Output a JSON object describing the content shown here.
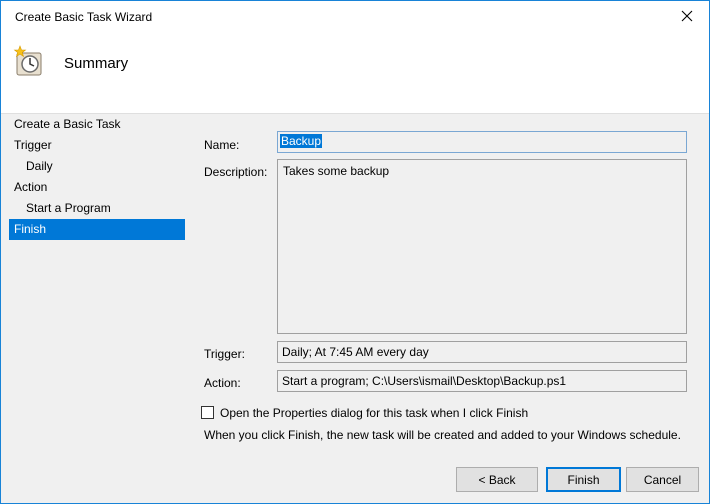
{
  "window": {
    "title": "Create Basic Task Wizard"
  },
  "header": {
    "title": "Summary"
  },
  "nav": {
    "items": [
      {
        "label": "Create a Basic Task"
      },
      {
        "label": "Trigger"
      },
      {
        "label": "Daily"
      },
      {
        "label": "Action"
      },
      {
        "label": "Start a Program"
      },
      {
        "label": "Finish"
      }
    ]
  },
  "form": {
    "name_label": "Name:",
    "name_value": "Backup",
    "description_label": "Description:",
    "description_value": "Takes some backup",
    "trigger_label": "Trigger:",
    "trigger_value": "Daily; At 7:45 AM every day",
    "action_label": "Action:",
    "action_value": "Start a program; C:\\Users\\ismail\\Desktop\\Backup.ps1",
    "checkbox_label": "Open the Properties dialog for this task when I click Finish",
    "checkbox_checked": false,
    "info_text": "When you click Finish, the new task will be created and added to your Windows schedule."
  },
  "buttons": {
    "back": "< Back",
    "finish": "Finish",
    "cancel": "Cancel"
  },
  "colors": {
    "accent": "#0078d7",
    "window_border": "#1883d7",
    "background": "#f0f0f0"
  }
}
